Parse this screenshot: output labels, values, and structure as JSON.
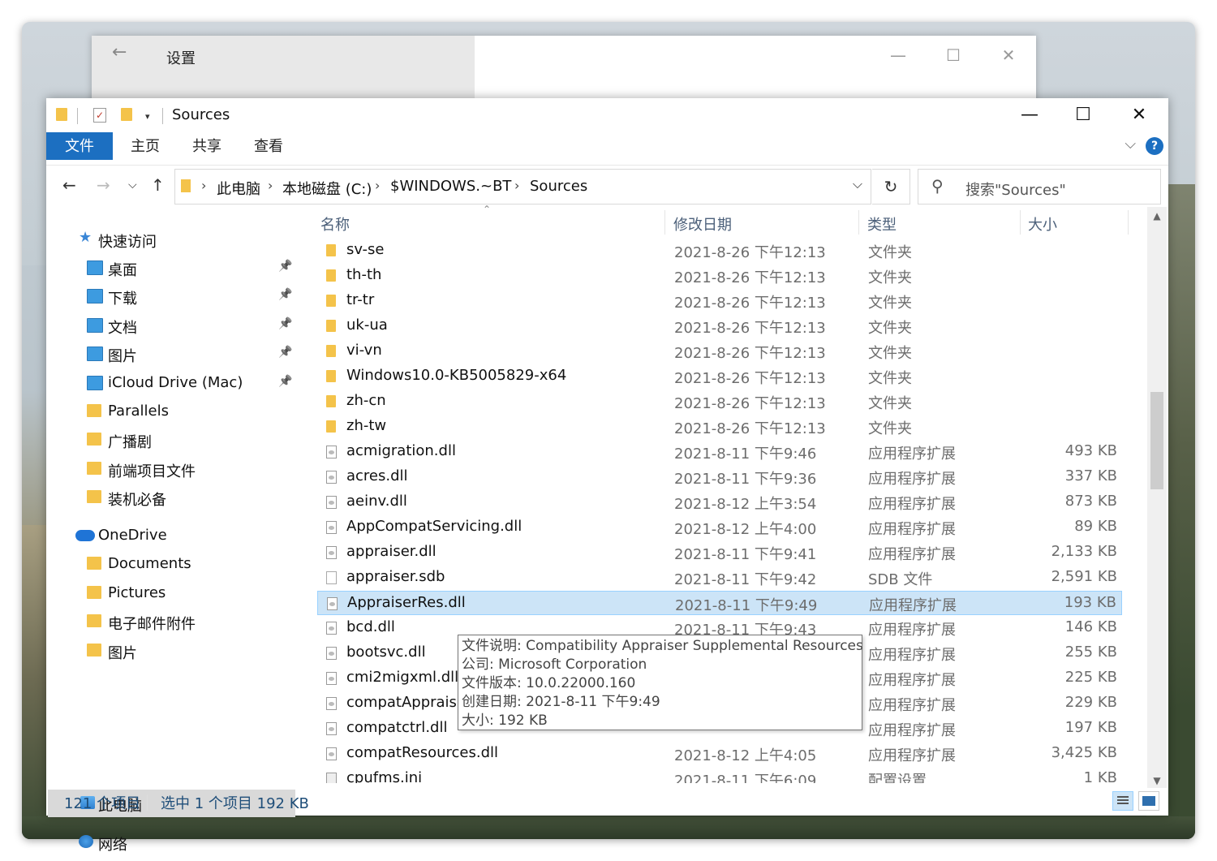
{
  "settings_window": {
    "title": "设置",
    "back_icon": "←",
    "minimize": "—",
    "maximize": "☐",
    "close": "✕"
  },
  "explorer": {
    "title": "Sources",
    "window_controls": {
      "minimize": "—",
      "maximize": "☐",
      "close": "✕"
    },
    "ribbon": {
      "tabs": [
        "文件",
        "主页",
        "共享",
        "查看"
      ],
      "collapse_icon": "chevron-down-icon",
      "help": "?"
    },
    "address": {
      "crumbs": [
        "此电脑",
        "本地磁盘 (C:)",
        "$WINDOWS.~BT",
        "Sources"
      ],
      "search_placeholder": "搜索\"Sources\""
    },
    "nav": {
      "quick_access": "快速访问",
      "quick_items": [
        {
          "label": "桌面",
          "pinned": true,
          "icon": "blue"
        },
        {
          "label": "下载",
          "pinned": true,
          "icon": "blue"
        },
        {
          "label": "文档",
          "pinned": true,
          "icon": "blue"
        },
        {
          "label": "图片",
          "pinned": true,
          "icon": "blue"
        },
        {
          "label": "iCloud Drive (Mac)",
          "pinned": true,
          "icon": "blue"
        },
        {
          "label": "Parallels",
          "pinned": false,
          "icon": "yellow"
        },
        {
          "label": "广播剧",
          "pinned": false,
          "icon": "yellow"
        },
        {
          "label": "前端项目文件",
          "pinned": false,
          "icon": "yellow"
        },
        {
          "label": "装机必备",
          "pinned": false,
          "icon": "yellow"
        }
      ],
      "onedrive": "OneDrive",
      "onedrive_items": [
        "Documents",
        "Pictures",
        "电子邮件附件",
        "图片"
      ],
      "this_pc": "此电脑",
      "network": "网络"
    },
    "columns": {
      "name": "名称",
      "date": "修改日期",
      "type": "类型",
      "size": "大小"
    },
    "files": [
      {
        "name": "sv-se",
        "date": "2021-8-26 下午12:13",
        "type": "文件夹",
        "size": "",
        "kind": "folder"
      },
      {
        "name": "th-th",
        "date": "2021-8-26 下午12:13",
        "type": "文件夹",
        "size": "",
        "kind": "folder"
      },
      {
        "name": "tr-tr",
        "date": "2021-8-26 下午12:13",
        "type": "文件夹",
        "size": "",
        "kind": "folder"
      },
      {
        "name": "uk-ua",
        "date": "2021-8-26 下午12:13",
        "type": "文件夹",
        "size": "",
        "kind": "folder"
      },
      {
        "name": "vi-vn",
        "date": "2021-8-26 下午12:13",
        "type": "文件夹",
        "size": "",
        "kind": "folder"
      },
      {
        "name": "Windows10.0-KB5005829-x64",
        "date": "2021-8-26 下午12:13",
        "type": "文件夹",
        "size": "",
        "kind": "folder"
      },
      {
        "name": "zh-cn",
        "date": "2021-8-26 下午12:13",
        "type": "文件夹",
        "size": "",
        "kind": "folder"
      },
      {
        "name": "zh-tw",
        "date": "2021-8-26 下午12:13",
        "type": "文件夹",
        "size": "",
        "kind": "folder"
      },
      {
        "name": "acmigration.dll",
        "date": "2021-8-11 下午9:46",
        "type": "应用程序扩展",
        "size": "493 KB",
        "kind": "dll"
      },
      {
        "name": "acres.dll",
        "date": "2021-8-11 下午9:36",
        "type": "应用程序扩展",
        "size": "337 KB",
        "kind": "dll"
      },
      {
        "name": "aeinv.dll",
        "date": "2021-8-12 上午3:54",
        "type": "应用程序扩展",
        "size": "873 KB",
        "kind": "dll"
      },
      {
        "name": "AppCompatServicing.dll",
        "date": "2021-8-12 上午4:00",
        "type": "应用程序扩展",
        "size": "89 KB",
        "kind": "dll"
      },
      {
        "name": "appraiser.dll",
        "date": "2021-8-11 下午9:41",
        "type": "应用程序扩展",
        "size": "2,133 KB",
        "kind": "dll"
      },
      {
        "name": "appraiser.sdb",
        "date": "2021-8-11 下午9:42",
        "type": "SDB 文件",
        "size": "2,591 KB",
        "kind": "doc"
      },
      {
        "name": "AppraiserRes.dll",
        "date": "2021-8-11 下午9:49",
        "type": "应用程序扩展",
        "size": "193 KB",
        "kind": "dll",
        "selected": true
      },
      {
        "name": "bcd.dll",
        "date": "2021-8-11 下午9:43",
        "type": "应用程序扩展",
        "size": "146 KB",
        "kind": "dll"
      },
      {
        "name": "bootsvc.dll",
        "date": "",
        "type": "应用程序扩展",
        "size": "255 KB",
        "kind": "dll"
      },
      {
        "name": "cmi2migxml.dll",
        "date": "",
        "type": "应用程序扩展",
        "size": "225 KB",
        "kind": "dll"
      },
      {
        "name": "compatApprais",
        "date": "",
        "type": "应用程序扩展",
        "size": "229 KB",
        "kind": "dll"
      },
      {
        "name": "compatctrl.dll",
        "date": "",
        "type": "应用程序扩展",
        "size": "197 KB",
        "kind": "dll"
      },
      {
        "name": "compatResources.dll",
        "date": "2021-8-12 上午4:05",
        "type": "应用程序扩展",
        "size": "3,425 KB",
        "kind": "dll"
      },
      {
        "name": "cpufms.ini",
        "date": "2021-8-11 下午6:09",
        "type": "配置设置",
        "size": "1 KB",
        "kind": "ini"
      }
    ],
    "tooltip": [
      "文件说明: Compatibility Appraiser Supplemental Resources",
      "公司: Microsoft Corporation",
      "文件版本: 10.0.22000.160",
      "创建日期: 2021-8-11 下午9:49",
      "大小: 192 KB"
    ],
    "status": {
      "count": "121 个项目",
      "selection": "选中 1 个项目  192 KB"
    }
  }
}
